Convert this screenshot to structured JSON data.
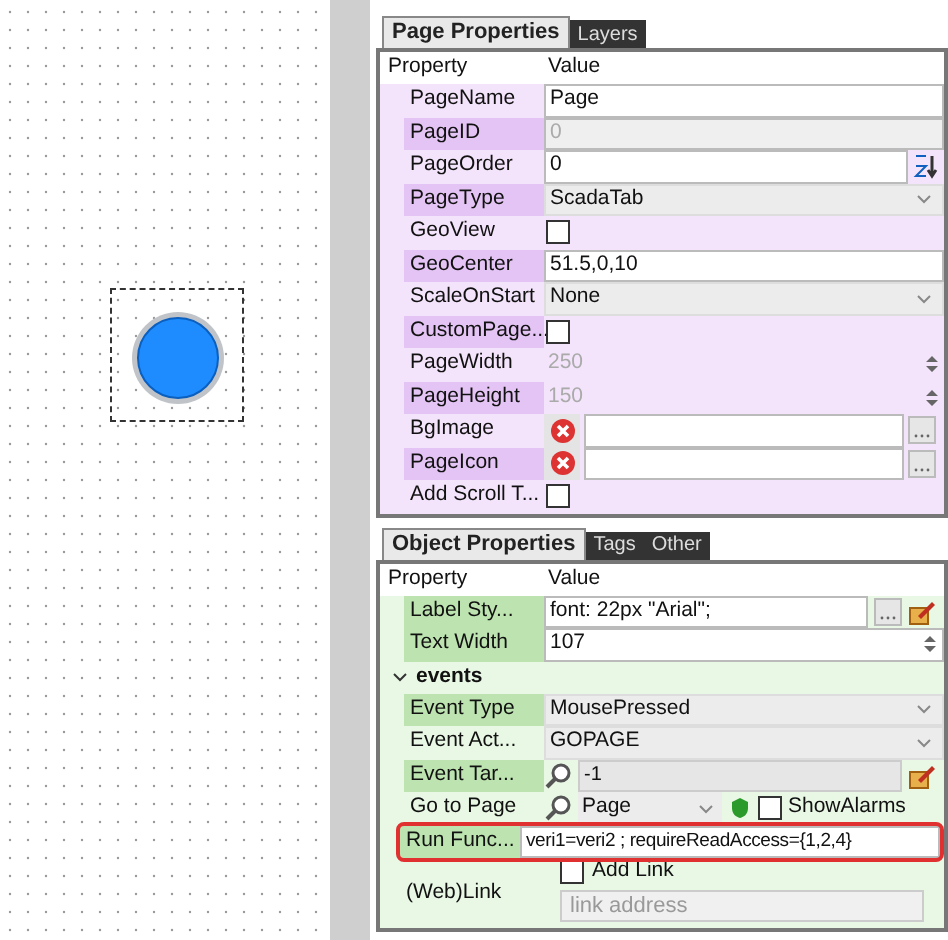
{
  "page_panel": {
    "tabs": [
      {
        "label": "Page Properties",
        "selected": true
      },
      {
        "label": "Layers",
        "selected": false
      }
    ],
    "header": {
      "property": "Property",
      "value": "Value"
    },
    "rows": [
      {
        "label": "PageName",
        "kind": "text",
        "value": "Page",
        "highlighted": false
      },
      {
        "label": "PageID",
        "kind": "text",
        "value": "0",
        "highlighted": true,
        "disabled": true
      },
      {
        "label": "PageOrder",
        "kind": "sort",
        "value": "0",
        "highlighted": false
      },
      {
        "label": "PageType",
        "kind": "dropdown",
        "value": "ScadaTab",
        "highlighted": true
      },
      {
        "label": "GeoView",
        "kind": "checkbox",
        "checked": false,
        "highlighted": false
      },
      {
        "label": "GeoCenter",
        "kind": "text",
        "value": "51.5,0,10",
        "highlighted": true
      },
      {
        "label": "ScaleOnStart",
        "kind": "dropdown",
        "value": "None",
        "highlighted": false
      },
      {
        "label": "CustomPage...",
        "kind": "checkbox",
        "checked": false,
        "highlighted": true
      },
      {
        "label": "PageWidth",
        "kind": "spin",
        "value": "250",
        "highlighted": false,
        "disabled": true
      },
      {
        "label": "PageHeight",
        "kind": "spin",
        "value": "150",
        "highlighted": true,
        "disabled": true
      },
      {
        "label": "BgImage",
        "kind": "image",
        "highlighted": false
      },
      {
        "label": "PageIcon",
        "kind": "image",
        "highlighted": true
      },
      {
        "label": "Add Scroll T...",
        "kind": "checkbox",
        "checked": false,
        "highlighted": false
      }
    ]
  },
  "object_panel": {
    "tabs": [
      {
        "label": "Object Properties",
        "selected": true
      },
      {
        "label": "Tags",
        "selected": false
      },
      {
        "label": "Other",
        "selected": false
      }
    ],
    "header": {
      "property": "Property",
      "value": "Value"
    },
    "rows": [
      {
        "label": "Label Sty...",
        "kind": "style",
        "value": "font: 22px \"Arial\";",
        "highlighted": true
      },
      {
        "label": "Text Width",
        "kind": "spin",
        "value": "107",
        "highlighted": true
      },
      {
        "label": "events",
        "kind": "group",
        "expanded": true
      },
      {
        "label": "Event Type",
        "kind": "dropdown",
        "value": "MousePressed",
        "highlighted": true
      },
      {
        "label": "Event Act...",
        "kind": "dropdown",
        "value": "GOPAGE",
        "highlighted": false
      },
      {
        "label": "Event Tar...",
        "kind": "lookup",
        "value": "-1",
        "highlighted": true
      },
      {
        "label": "Go to Page",
        "kind": "page",
        "value": "Page",
        "checkbox_label": "ShowAlarms",
        "checked": false,
        "highlighted": false
      },
      {
        "label": "Run Func...",
        "kind": "text",
        "value": "veri1=veri2 ; requireReadAccess={1,2,4}",
        "highlighted": true,
        "outlined": true
      },
      {
        "label": "(Web)Link",
        "kind": "link",
        "checkbox_label": "Add Link",
        "checked": false,
        "placeholder": "link address"
      }
    ]
  }
}
